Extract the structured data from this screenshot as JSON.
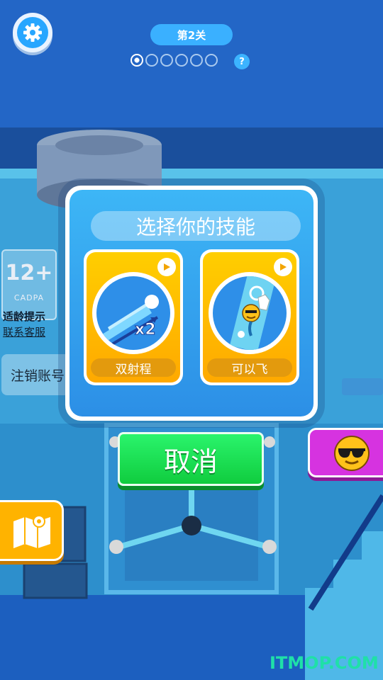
{
  "header": {
    "level_label": "第2关",
    "progress_dots": 6,
    "progress_current": 1,
    "help_label": "?"
  },
  "side": {
    "age_rating": "12+",
    "age_rating_org": "CADPA",
    "age_tip": "适龄提示",
    "contact_service": "联系客服",
    "logout_label": "注销账号"
  },
  "skill_dialog": {
    "title": "选择你的技能",
    "skills": [
      {
        "label": "双射程",
        "icon": "double-range-icon",
        "multiplier": "x2"
      },
      {
        "label": "可以飞",
        "icon": "fly-icon"
      }
    ],
    "cancel_label": "取消"
  },
  "watermark": "ITMOP.COM",
  "colors": {
    "background": "#1f5fc0",
    "dialog": "#3db6f6",
    "skill_card": "#ffbe00",
    "cancel_button": "#1bd94f",
    "emoji_button": "#d633e0",
    "map_button": "#ffb300"
  }
}
